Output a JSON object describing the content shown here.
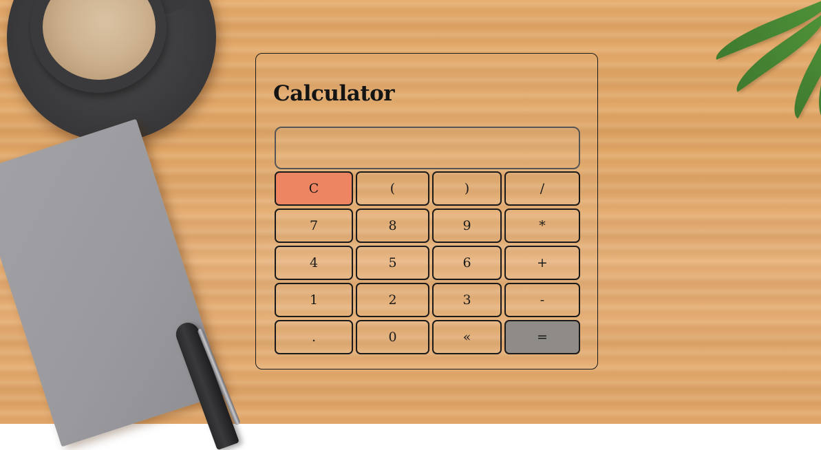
{
  "calculator": {
    "title": "Calculator",
    "display_value": "",
    "keys": [
      {
        "label": "C",
        "name": "clear-button",
        "variant": "clear"
      },
      {
        "label": "(",
        "name": "open-paren-button",
        "variant": ""
      },
      {
        "label": ")",
        "name": "close-paren-button",
        "variant": ""
      },
      {
        "label": "/",
        "name": "divide-button",
        "variant": ""
      },
      {
        "label": "7",
        "name": "digit-7-button",
        "variant": ""
      },
      {
        "label": "8",
        "name": "digit-8-button",
        "variant": ""
      },
      {
        "label": "9",
        "name": "digit-9-button",
        "variant": ""
      },
      {
        "label": "*",
        "name": "multiply-button",
        "variant": ""
      },
      {
        "label": "4",
        "name": "digit-4-button",
        "variant": ""
      },
      {
        "label": "5",
        "name": "digit-5-button",
        "variant": ""
      },
      {
        "label": "6",
        "name": "digit-6-button",
        "variant": ""
      },
      {
        "label": "+",
        "name": "add-button",
        "variant": ""
      },
      {
        "label": "1",
        "name": "digit-1-button",
        "variant": ""
      },
      {
        "label": "2",
        "name": "digit-2-button",
        "variant": ""
      },
      {
        "label": "3",
        "name": "digit-3-button",
        "variant": ""
      },
      {
        "label": "-",
        "name": "subtract-button",
        "variant": ""
      },
      {
        "label": ".",
        "name": "decimal-button",
        "variant": ""
      },
      {
        "label": "0",
        "name": "digit-0-button",
        "variant": ""
      },
      {
        "label": "«",
        "name": "backspace-button",
        "variant": ""
      },
      {
        "label": "=",
        "name": "equals-button",
        "variant": "equals"
      }
    ]
  },
  "colors": {
    "clear_key": "#ed8462",
    "equals_key": "#8f8b87",
    "border": "#1a1a1a"
  },
  "background_objects": [
    "coffee-cup-icon",
    "notebook",
    "pen",
    "plant-leaves"
  ]
}
